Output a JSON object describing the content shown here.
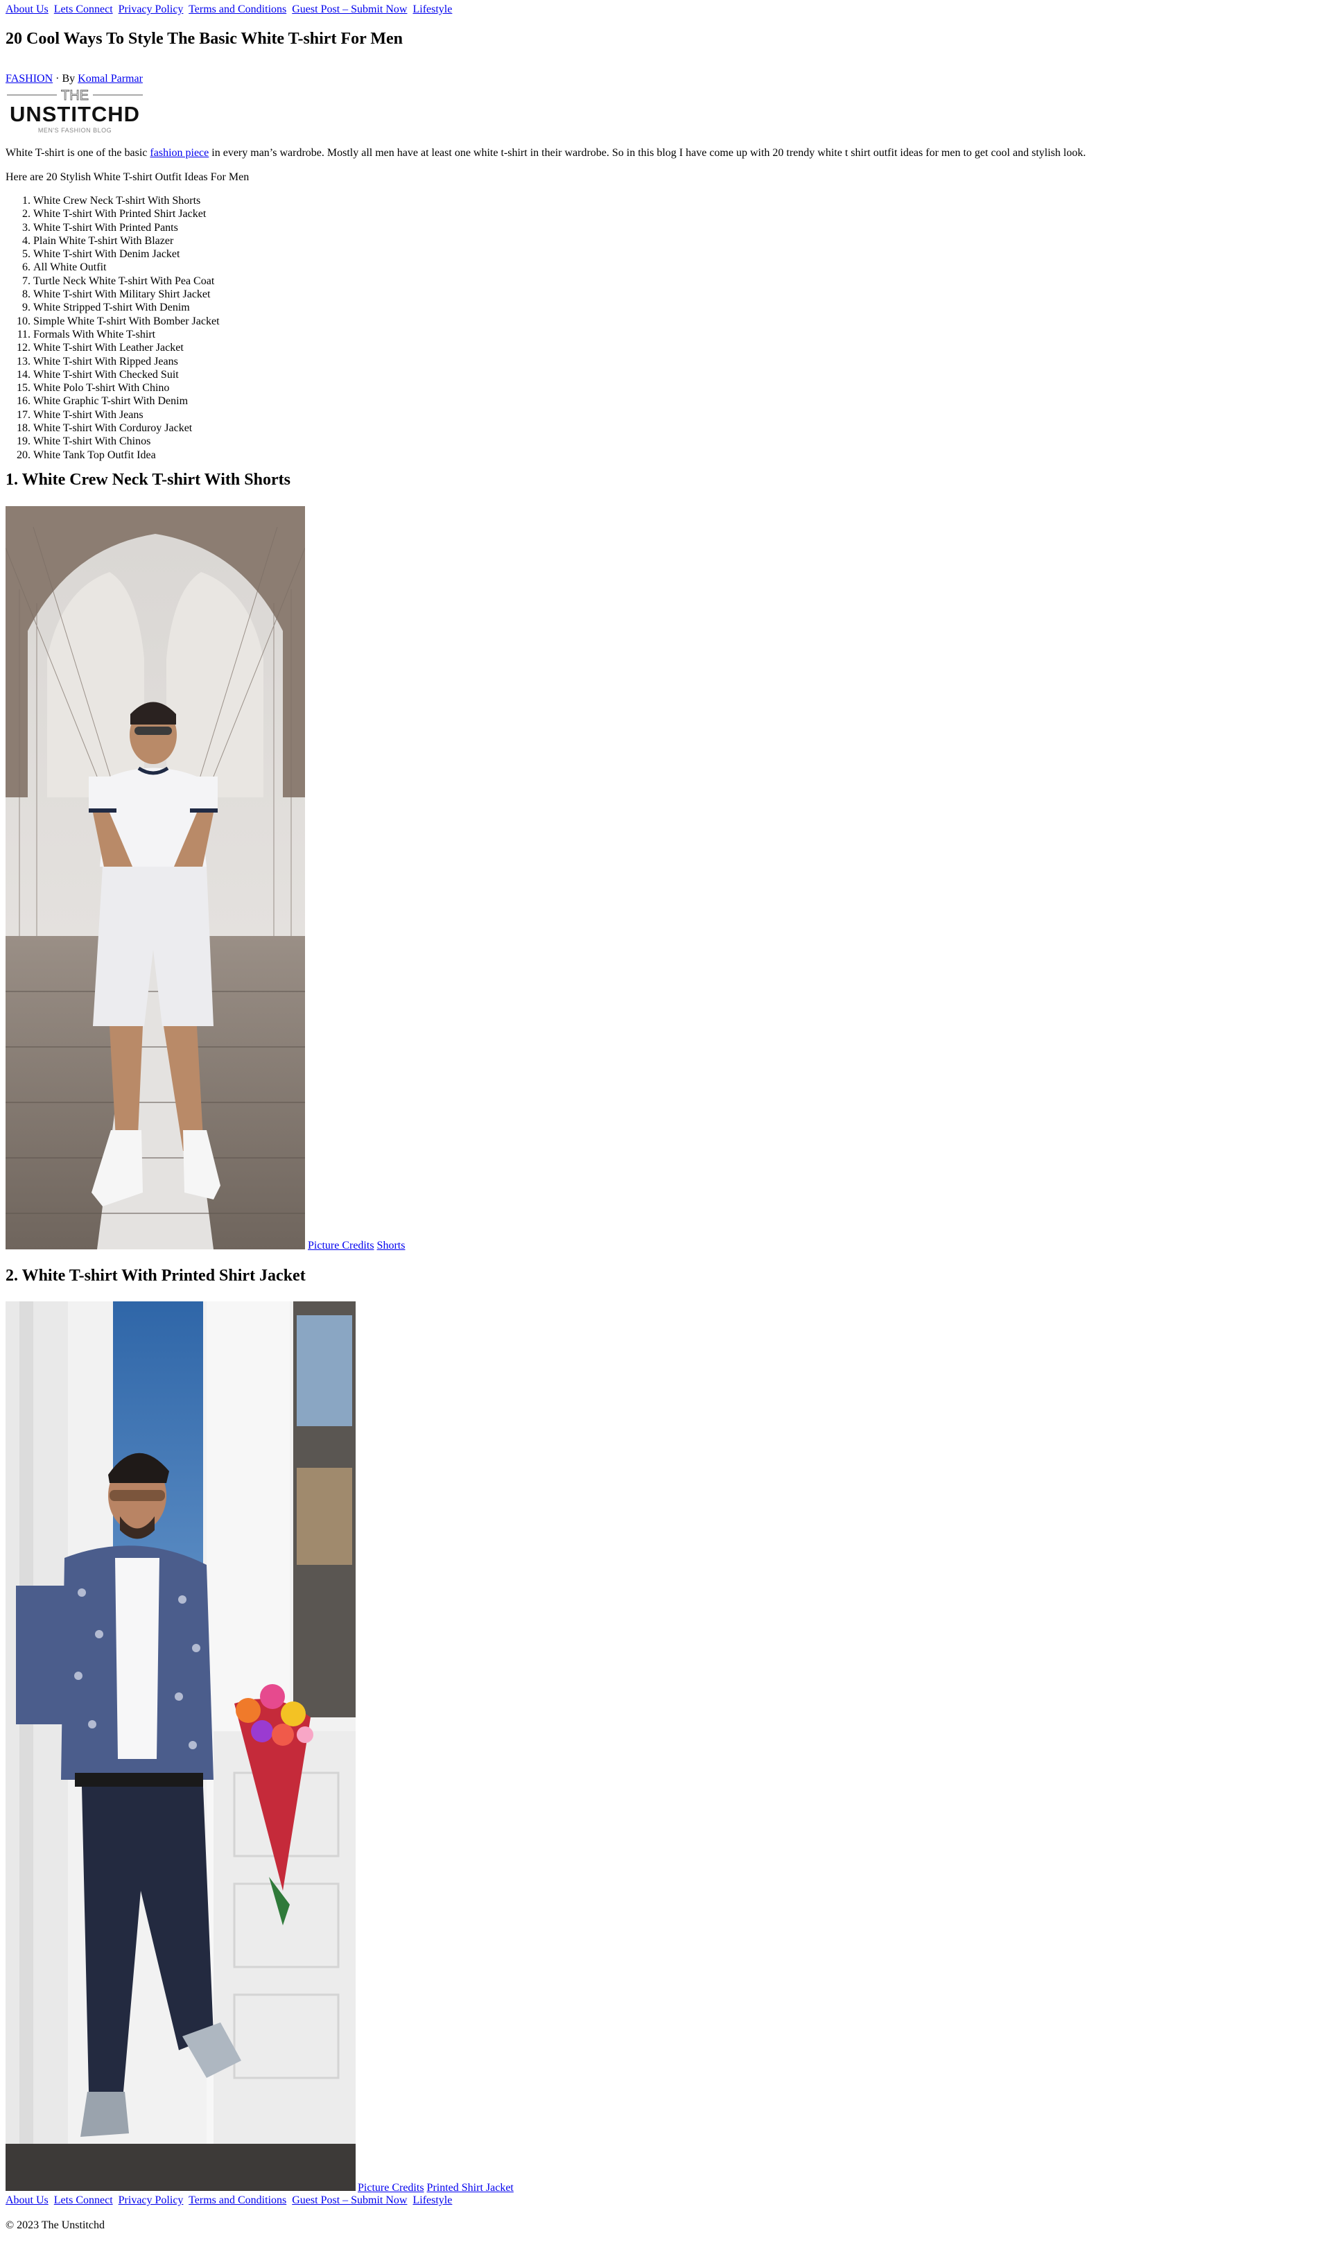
{
  "nav": {
    "items": [
      "About Us",
      "Lets Connect",
      "Privacy Policy",
      "Terms and Conditions",
      "Guest Post – Submit Now",
      "Lifestyle"
    ]
  },
  "article": {
    "title": "20 Cool Ways To Style The Basic White T-shirt For Men",
    "category": "FASHION",
    "by": "· By",
    "author": "Komal Parmar",
    "logo": {
      "the": "THE",
      "brand": "UNSTITCHD",
      "tagline": "MEN'S FASHION BLOG"
    },
    "intro_before": "White T-shirt is one of the basic ",
    "intro_link": "fashion piece",
    "intro_after": " in every man’s wardrobe. Mostly all men have at least one white t-shirt in their wardrobe. So in this blog I have come up with 20 trendy white t shirt outfit ideas for men to get cool and stylish look.",
    "lead": "Here are 20 Stylish White T-shirt Outfit Ideas For Men",
    "toc": [
      "White Crew Neck T-shirt With Shorts",
      "White T-shirt With Printed Shirt Jacket",
      "White T-shirt With Printed Pants",
      "Plain White T-shirt With Blazer",
      "White T-shirt With Denim Jacket",
      "All White Outfit",
      "Turtle Neck White T-shirt With Pea Coat",
      "White T-shirt With Military Shirt Jacket",
      "White Stripped T-shirt With Denim",
      "Simple White T-shirt With Bomber Jacket",
      "Formals With White T-shirt",
      "White T-shirt With Leather Jacket",
      "White T-shirt With Ripped Jeans",
      "White T-shirt With Checked Suit",
      "White Polo T-shirt With Chino",
      "White Graphic T-shirt With Denim",
      "White T-shirt With Jeans",
      "White T-shirt With Corduroy Jacket",
      "White T-shirt With Chinos",
      "White Tank Top Outfit Idea"
    ],
    "sections": [
      {
        "heading": "1. White Crew Neck T-shirt With Shorts",
        "credit": "Picture Credits",
        "product": "Shorts"
      },
      {
        "heading": "2. White T-shirt With Printed Shirt Jacket",
        "credit": "Picture Credits",
        "product": "Printed Shirt Jacket"
      }
    ]
  },
  "footer": {
    "items": [
      "About Us",
      "Lets Connect",
      "Privacy Policy",
      "Terms and Conditions",
      "Guest Post – Submit Now",
      "Lifestyle"
    ],
    "copyright": "© 2023 The Unstitchd"
  },
  "colors": {
    "link": "#0000ee",
    "text": "#000000",
    "background": "#ffffff"
  }
}
